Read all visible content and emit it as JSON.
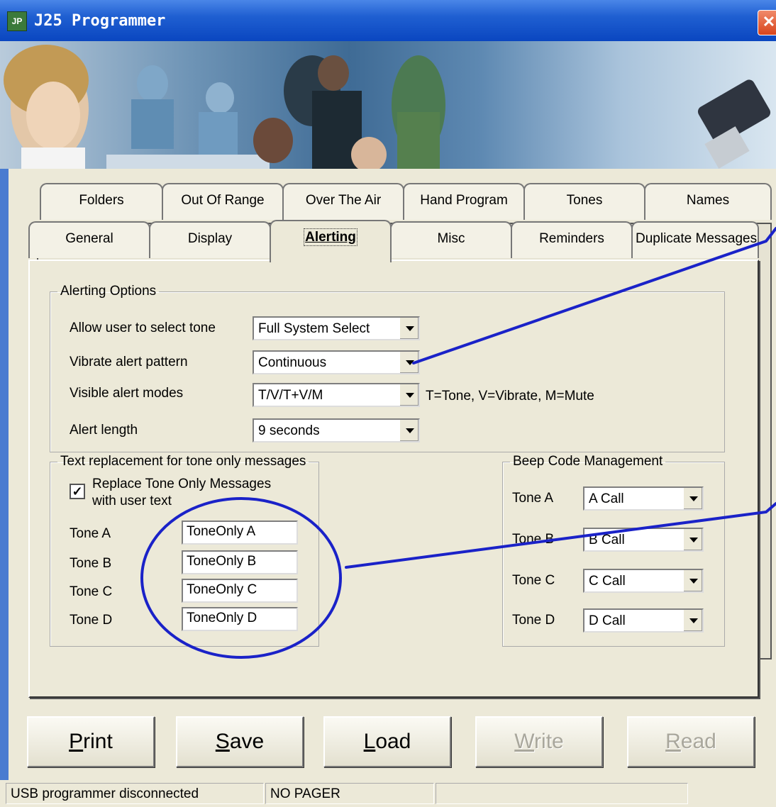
{
  "window": {
    "title": "J25 Programmer",
    "close_glyph": "✕",
    "icon_text": "JP"
  },
  "tabs_back": [
    "Folders",
    "Out Of Range",
    "Over The Air",
    "Hand Program",
    "Tones",
    "Names"
  ],
  "tabs_front": [
    "General",
    "Display",
    "Alerting",
    "Misc",
    "Reminders",
    "Duplicate Messages"
  ],
  "active_tab": "Alerting",
  "alerting_options": {
    "legend": "Alerting Options",
    "rows": [
      {
        "label": "Allow user to select tone",
        "value": "Full System Select"
      },
      {
        "label": "Vibrate alert pattern",
        "value": "Continuous"
      },
      {
        "label": "Visible alert modes",
        "value": "T/V/T+V/M"
      },
      {
        "label": "Alert length",
        "value": "9 seconds"
      }
    ],
    "modes_hint": "T=Tone, V=Vibrate, M=Mute"
  },
  "text_replacement": {
    "legend": "Text replacement for tone only messages",
    "checkbox_label_line1": "Replace Tone Only Messages",
    "checkbox_label_line2": "with user text",
    "checked": true,
    "check_glyph": "✓",
    "rows": [
      {
        "label": "Tone A",
        "value": "ToneOnly A"
      },
      {
        "label": "Tone B",
        "value": "ToneOnly B"
      },
      {
        "label": "Tone C",
        "value": "ToneOnly C"
      },
      {
        "label": "Tone D",
        "value": "ToneOnly D"
      }
    ]
  },
  "beep_code": {
    "legend": "Beep Code Management",
    "rows": [
      {
        "label": "Tone A",
        "value": "A Call"
      },
      {
        "label": "Tone B",
        "value": "B Call"
      },
      {
        "label": "Tone C",
        "value": "C Call"
      },
      {
        "label": "Tone D",
        "value": "D Call"
      }
    ]
  },
  "buttons": [
    {
      "mnemonic": "P",
      "rest": "rint",
      "enabled": true
    },
    {
      "mnemonic": "S",
      "rest": "ave",
      "enabled": true
    },
    {
      "mnemonic": "L",
      "rest": "oad",
      "enabled": true
    },
    {
      "mnemonic": "W",
      "rest": "rite",
      "enabled": false
    },
    {
      "mnemonic": "R",
      "rest": "ead",
      "enabled": false
    }
  ],
  "status": {
    "connection": "USB programmer disconnected",
    "pager": "NO PAGER",
    "extra": ""
  },
  "colors": {
    "titlebar": "#0a46c0",
    "annotation": "#1a22c8",
    "face": "#ece9d8",
    "close": "#d8451c"
  }
}
